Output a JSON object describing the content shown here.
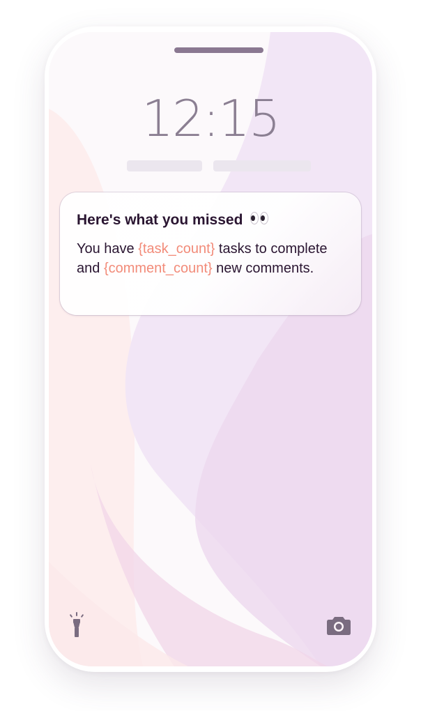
{
  "lock_screen": {
    "time": "12:15"
  },
  "notification": {
    "title": "Here's what you missed",
    "title_emoji_icon": "eyes-icon",
    "body": {
      "part1": "You have ",
      "var1": "{task_count}",
      "part2": " tasks to complete and ",
      "var2": "{comment_count}",
      "part3": " new comments."
    }
  },
  "shortcuts": {
    "left_icon": "flashlight-icon",
    "right_icon": "camera-icon"
  },
  "colors": {
    "text_primary": "#2a1531",
    "variable_accent": "#f28b79",
    "clock": "#8b7f92",
    "icon": "#7a6c80"
  }
}
